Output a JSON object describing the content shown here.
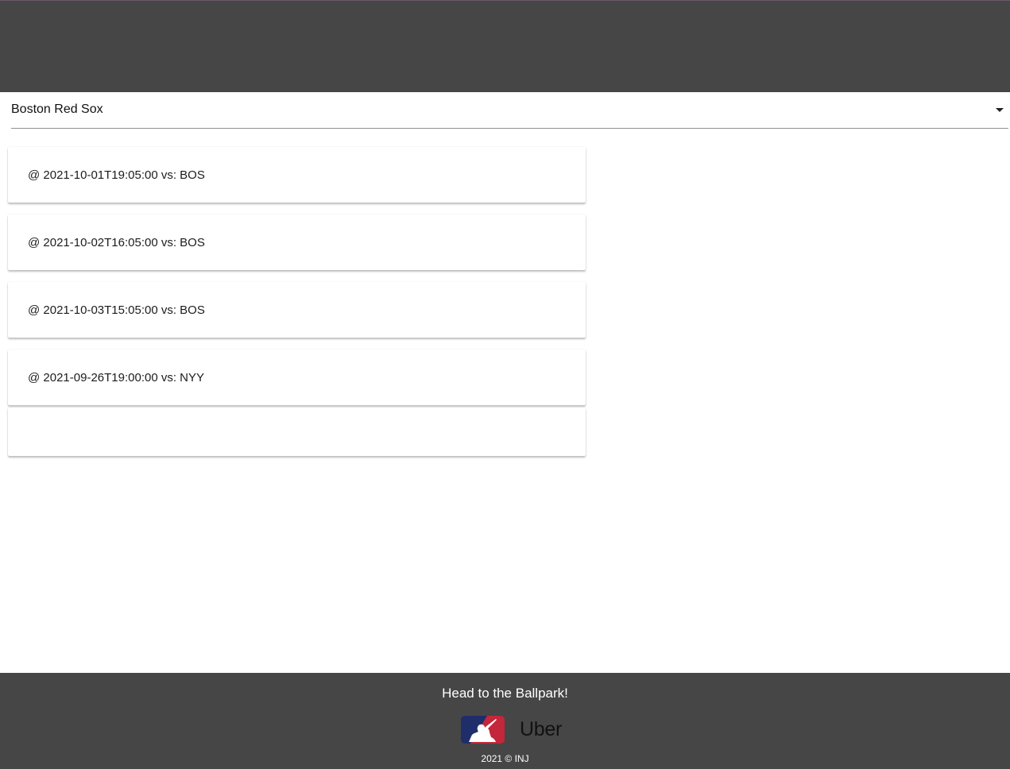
{
  "team_select": {
    "selected": "Boston Red Sox"
  },
  "games": [
    {
      "label": "@ 2021-10-01T19:05:00 vs: BOS"
    },
    {
      "label": "@ 2021-10-02T16:05:00 vs: BOS"
    },
    {
      "label": "@ 2021-10-03T15:05:00 vs: BOS"
    },
    {
      "label": "@ 2021-09-26T19:00:00 vs: NYY"
    }
  ],
  "footer": {
    "tagline": "Head to the Ballpark!",
    "logos": [
      {
        "name": "mlb-logo",
        "icon": "mlb-batter-icon"
      },
      {
        "name": "uber-logo",
        "text": "Uber"
      }
    ],
    "copyright": "2021 © INJ"
  },
  "colors": {
    "header_bg": "#464646",
    "footer_bg": "#464646",
    "mlb_blue": "#1f2d6b",
    "mlb_red": "#c4263b"
  }
}
